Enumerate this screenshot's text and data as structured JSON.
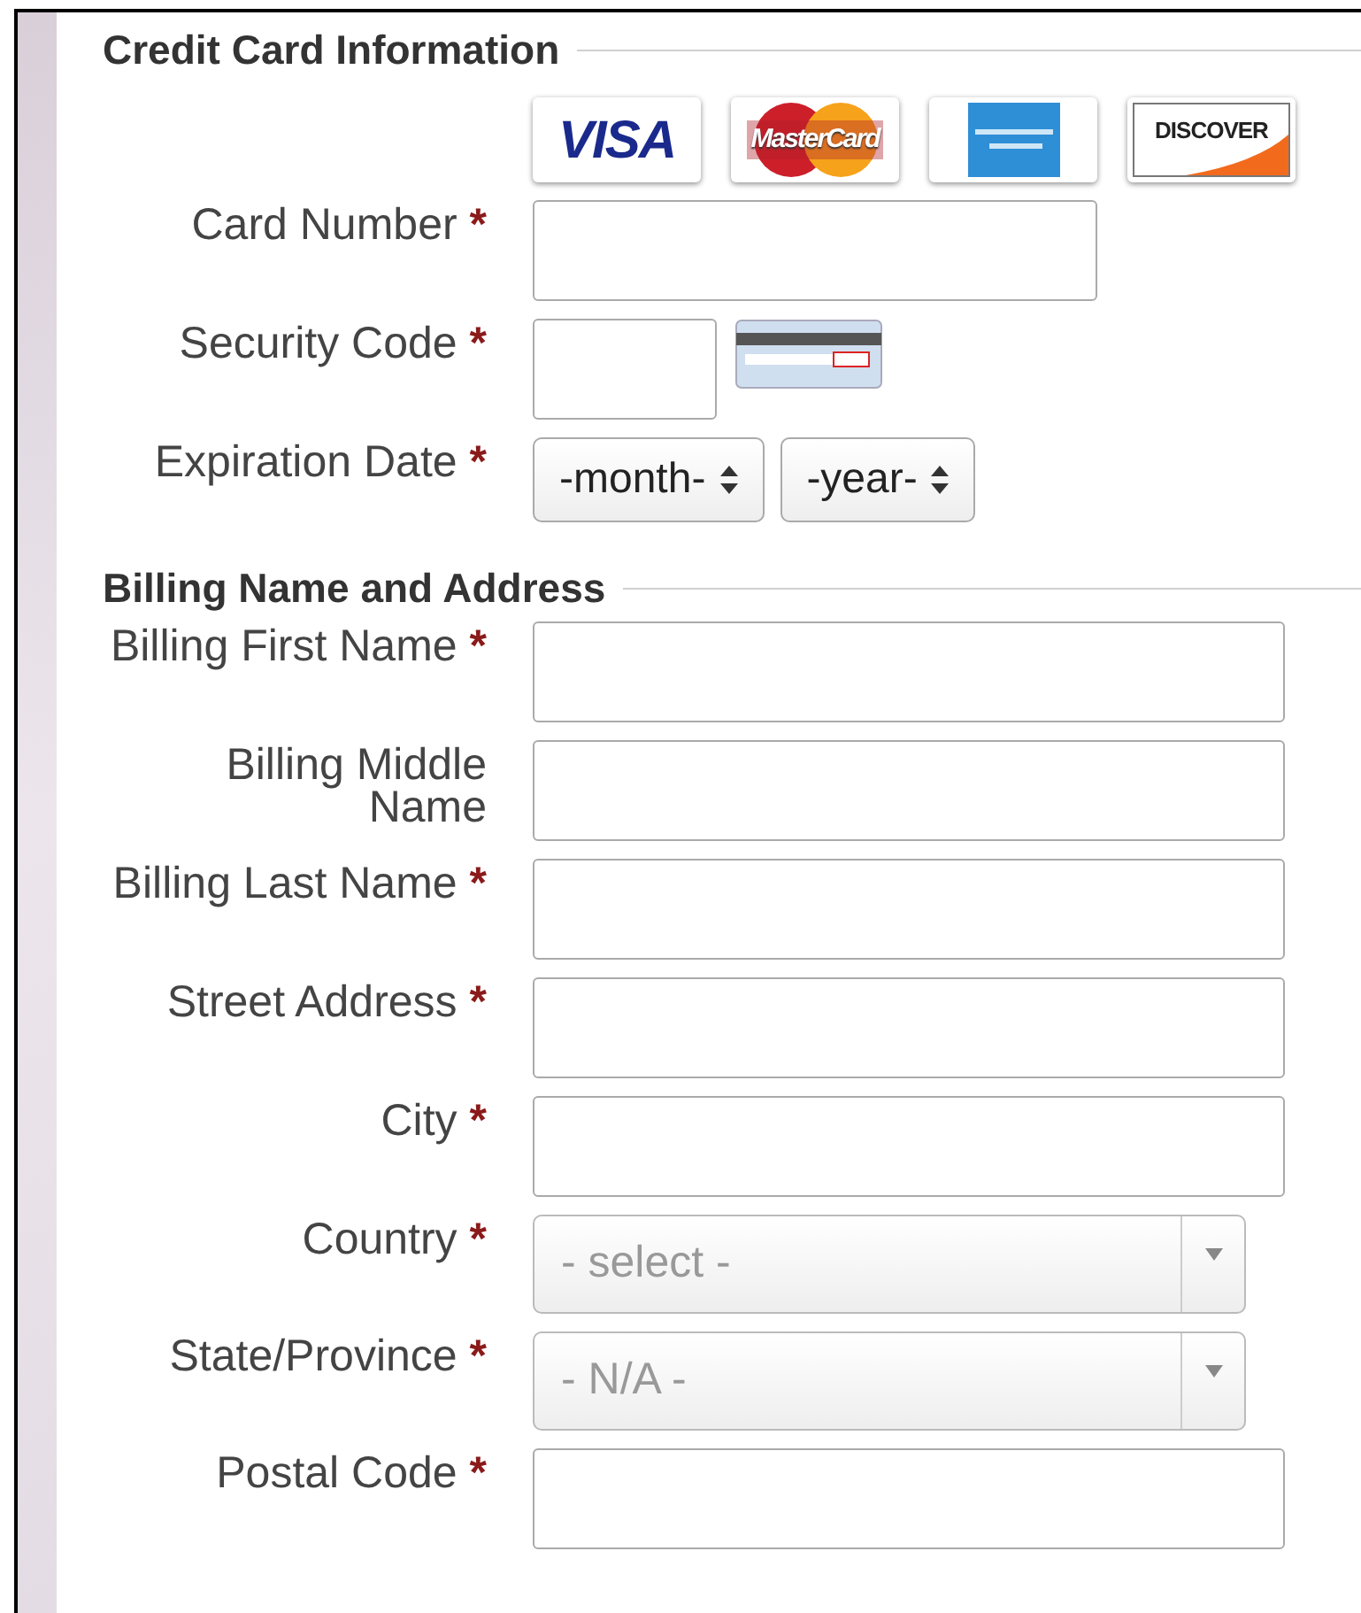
{
  "sections": [
    {
      "title": "Credit Card Information",
      "card_logos": [
        {
          "kind": "visa",
          "text": "VISA"
        },
        {
          "kind": "mastercard",
          "text": "MasterCard"
        },
        {
          "kind": "amex"
        },
        {
          "kind": "discover",
          "text": "DISCOVER"
        }
      ],
      "fields": [
        {
          "kind": "short_text",
          "label": "Card Number",
          "marker": "*"
        },
        {
          "kind": "security",
          "label": "Security Code",
          "marker": "*"
        },
        {
          "kind": "expiry",
          "label": "Expiration Date",
          "marker": "*",
          "selects": [
            {
              "value": "-month-"
            },
            {
              "value": "-year-"
            }
          ]
        }
      ]
    },
    {
      "title": "Billing Name and Address",
      "fields": [
        {
          "kind": "text",
          "label": "Billing First Name",
          "marker": "*"
        },
        {
          "kind": "text",
          "label": "Billing Middle Name"
        },
        {
          "kind": "text",
          "label": "Billing Last Name",
          "marker": "*"
        },
        {
          "kind": "text",
          "label": "Street Address",
          "marker": "*"
        },
        {
          "kind": "text",
          "label": "City",
          "marker": "*"
        },
        {
          "kind": "select",
          "label": "Country",
          "marker": "*",
          "value": "- select -"
        },
        {
          "kind": "select",
          "label": "State/Province",
          "marker": "*",
          "value": "- N/A -"
        },
        {
          "kind": "text",
          "label": "Postal Code",
          "marker": "*"
        }
      ]
    }
  ]
}
